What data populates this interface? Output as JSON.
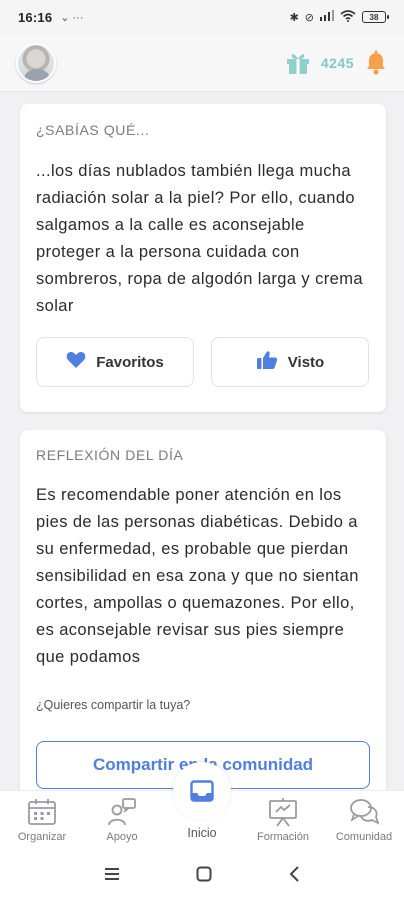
{
  "status_bar": {
    "time": "16:16",
    "extra": "⌄ ···",
    "battery": "38"
  },
  "header": {
    "points": "4245"
  },
  "card_fact": {
    "title": "¿SABÍAS QUÉ...",
    "body": "...los días nublados también llega mucha radiación solar a la piel? Por ello, cuando salgamos a la calle es aconsejable proteger a la persona cuidada con sombreros, ropa de algodón larga y crema solar",
    "favorites_label": "Favoritos",
    "seen_label": "Visto"
  },
  "card_reflection": {
    "title": "REFLEXIÓN DEL DÍA",
    "body": "Es recomendable poner atención en los pies de las personas diabéticas. Debido a su enfermedad, es probable que pierdan sensibilidad en esa zona y que no sientan cortes, ampollas o quemazones. Por ello, es aconsejable revisar sus pies siempre que podamos",
    "share_question": "¿Quieres compartir la tuya?",
    "share_button": "Compartir en la comunidad"
  },
  "bottom_nav": {
    "items": [
      {
        "label": "Organizar",
        "icon": "calendar-icon"
      },
      {
        "label": "Apoyo",
        "icon": "support-icon"
      },
      {
        "label": "Inicio",
        "icon": "home-inbox-icon"
      },
      {
        "label": "Formación",
        "icon": "presentation-icon"
      },
      {
        "label": "Comunidad",
        "icon": "chat-bubbles-icon"
      }
    ]
  },
  "colors": {
    "accent_blue": "#4f7fe0",
    "points_teal": "#7fc8c4",
    "bell_orange": "#f5a04a"
  }
}
